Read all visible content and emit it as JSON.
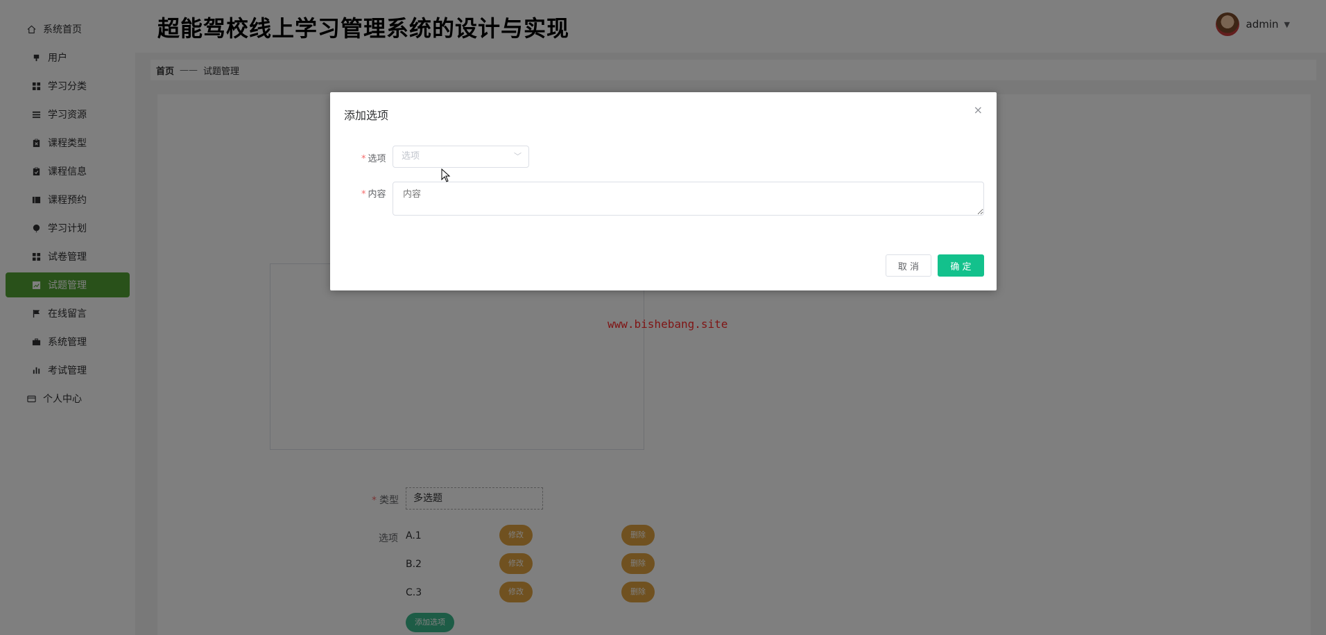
{
  "app": {
    "title": "超能驾校线上学习管理系统的设计与实现"
  },
  "user": {
    "name": "admin"
  },
  "sidebar": {
    "items": [
      {
        "label": "系统首页",
        "icon": "home-icon"
      },
      {
        "label": "用户",
        "icon": "user-icon"
      },
      {
        "label": "学习分类",
        "icon": "grid-icon"
      },
      {
        "label": "学习资源",
        "icon": "list-icon"
      },
      {
        "label": "课程类型",
        "icon": "clipboard-icon"
      },
      {
        "label": "课程信息",
        "icon": "clipboard-check-icon"
      },
      {
        "label": "课程预约",
        "icon": "book-icon"
      },
      {
        "label": "学习计划",
        "icon": "balloon-icon"
      },
      {
        "label": "试卷管理",
        "icon": "grid-icon"
      },
      {
        "label": "试题管理",
        "icon": "chart-icon",
        "active": true
      },
      {
        "label": "在线留言",
        "icon": "flag-icon"
      },
      {
        "label": "系统管理",
        "icon": "briefcase-icon"
      },
      {
        "label": "考试管理",
        "icon": "bar-chart-icon"
      },
      {
        "label": "个人中心",
        "icon": "card-icon"
      }
    ]
  },
  "breadcrumb": {
    "home": "首页",
    "separator": "——",
    "current": "试题管理"
  },
  "watermark": "www.bishebang.site",
  "form": {
    "type_label": "类型",
    "type_value": "多选题",
    "options_label": "选项",
    "options": [
      {
        "text": "A.1",
        "edit_label": "修改",
        "delete_label": "删除"
      },
      {
        "text": "B.2",
        "edit_label": "修改",
        "delete_label": "删除"
      },
      {
        "text": "C.3",
        "edit_label": "修改",
        "delete_label": "删除"
      }
    ],
    "add_option_label": "添加选项"
  },
  "dialog": {
    "title": "添加选项",
    "close": "×",
    "option_label": "选项",
    "option_placeholder": "选项",
    "content_label": "内容",
    "content_placeholder": "内容",
    "cancel_label": "取 消",
    "confirm_label": "确 定"
  },
  "colors": {
    "active_nav": "#52a334",
    "confirm_button": "#13c18c",
    "pill_button": "#e0a341",
    "add_button": "#3bb98c",
    "watermark": "#ff2a2a"
  }
}
